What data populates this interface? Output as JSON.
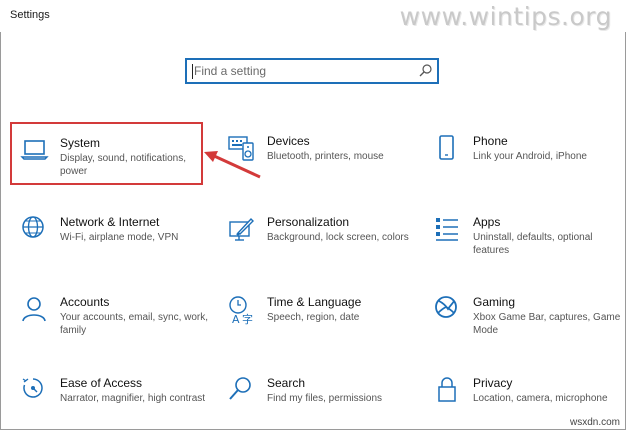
{
  "window": {
    "title": "Settings"
  },
  "watermark": "www.wintips.org",
  "search": {
    "placeholder": "Find a setting"
  },
  "tiles": [
    {
      "name": "System",
      "desc": "Display, sound, notifications, power",
      "icon": "laptop-icon"
    },
    {
      "name": "Devices",
      "desc": "Bluetooth, printers, mouse",
      "icon": "devices-icon"
    },
    {
      "name": "Phone",
      "desc": "Link your Android, iPhone",
      "icon": "phone-icon"
    },
    {
      "name": "Network & Internet",
      "desc": "Wi-Fi, airplane mode, VPN",
      "icon": "globe-icon"
    },
    {
      "name": "Personalization",
      "desc": "Background, lock screen, colors",
      "icon": "paint-icon"
    },
    {
      "name": "Apps",
      "desc": "Uninstall, defaults, optional features",
      "icon": "apps-list-icon"
    },
    {
      "name": "Accounts",
      "desc": "Your accounts, email, sync, work, family",
      "icon": "person-icon"
    },
    {
      "name": "Time & Language",
      "desc": "Speech, region, date",
      "icon": "time-language-icon"
    },
    {
      "name": "Gaming",
      "desc": "Xbox Game Bar, captures, Game Mode",
      "icon": "xbox-icon"
    },
    {
      "name": "Ease of Access",
      "desc": "Narrator, magnifier, high contrast",
      "icon": "ease-of-access-icon"
    },
    {
      "name": "Search",
      "desc": "Find my files, permissions",
      "icon": "search-icon"
    },
    {
      "name": "Privacy",
      "desc": "Location, camera, microphone",
      "icon": "lock-icon"
    }
  ],
  "footer": "wsxdn.com",
  "colors": {
    "accent": "#1d6fb8",
    "highlight": "#d33a3a"
  }
}
